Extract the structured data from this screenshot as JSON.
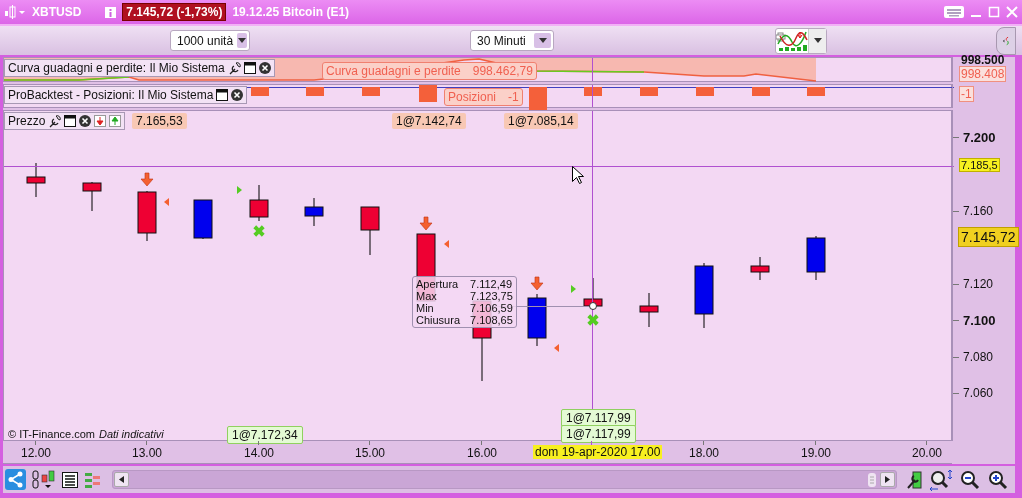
{
  "window": {
    "symbol": "XBTUSD",
    "price_change": "7.145,72 (-1,73%)",
    "description": "19.12.25 Bitcoin (E1)"
  },
  "toolbar": {
    "quantity": "1000 unità",
    "timeframe": "30 Minuti"
  },
  "panels": [
    {
      "kind": "equity",
      "title": "Curva guadagni e perdite: Il Mio Sistema",
      "value_label": "Curva guadagni e perdite",
      "value": "998.462,79",
      "axis_label": "998.500",
      "axis_tag": "998.408"
    },
    {
      "kind": "positions",
      "title": "ProBacktest - Posizioni: Il Mio Sistema",
      "value_label": "Posizioni",
      "value": "-1",
      "axis_tag": "-1"
    },
    {
      "kind": "price",
      "title": "Prezzo",
      "trade_tags": [
        {
          "kind": "sell",
          "text": "7.165,53"
        },
        {
          "kind": "sell",
          "text": "1@7.142,74"
        },
        {
          "kind": "sell",
          "text": "1@7.085,14"
        },
        {
          "kind": "buy",
          "text": "1@7.172,34"
        },
        {
          "kind": "buy",
          "text": "1@7.117,99"
        },
        {
          "kind": "buy",
          "text": "1@7.117,99"
        }
      ],
      "yticks": [
        {
          "label": "7.200",
          "major": true
        },
        {
          "label": "7.160",
          "major": false
        },
        {
          "label": "7.120",
          "major": false
        },
        {
          "label": "7.100",
          "major": true
        },
        {
          "label": "7.080",
          "major": false
        },
        {
          "label": "7.060",
          "major": false
        }
      ],
      "crosshair_tag": "7.185,5",
      "last_price_tag": "7.145,72",
      "tooltip": [
        {
          "label": "Apertura",
          "value": "7.112,49"
        },
        {
          "label": "Max",
          "value": "7.123,75"
        },
        {
          "label": "Min",
          "value": "7.106,59"
        },
        {
          "label": "Chiusura",
          "value": "7.108,65"
        }
      ],
      "copyright": "© IT-Finance.com",
      "note": "Dati indicativi"
    }
  ],
  "xaxis": {
    "ticks": [
      "12.00",
      "13.00",
      "14.00",
      "15.00",
      "16.00",
      "18.00",
      "19.00",
      "20.00"
    ],
    "cursor_label": "dom 19-apr-2020 17.00"
  }
}
